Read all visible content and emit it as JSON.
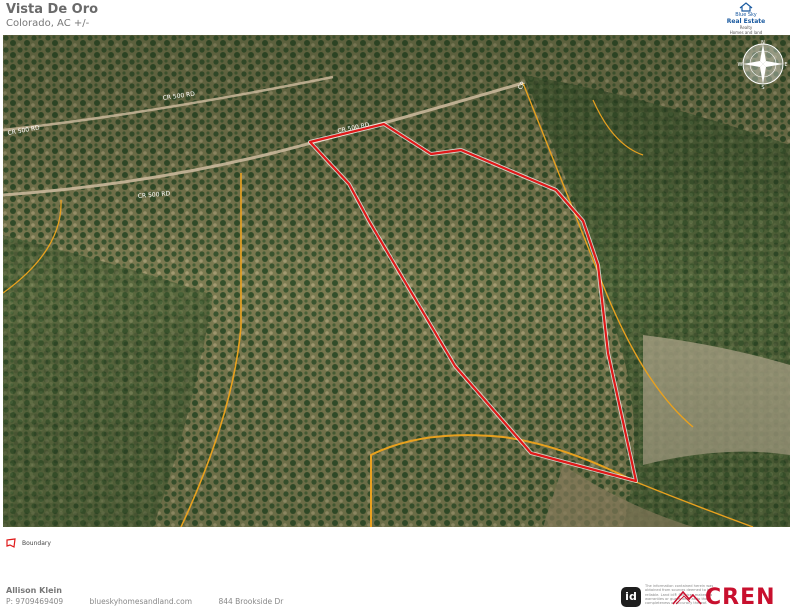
{
  "header": {
    "title": "Vista De Oro",
    "subtitle": "Colorado,  AC +/-"
  },
  "logo": {
    "line1": "Blue Sky",
    "line2": "Real Estate",
    "line3": "Realty",
    "line4": "Homes and land"
  },
  "compass": {
    "north": "N",
    "south": "S",
    "east": "E",
    "west": "W"
  },
  "map": {
    "road_labels": [
      "CR 500 RD",
      "CR 500 RD",
      "CR 500 RD",
      "CR 500 RD",
      "CR"
    ],
    "colors": {
      "boundary": "#e01919",
      "roads": "#e8a11f",
      "terrain": "#8b8a5a",
      "forest": "#3c5a2e"
    }
  },
  "legend": {
    "label": "Boundary",
    "icon": "boundary-polygon-icon"
  },
  "footer": {
    "agent_name": "Allison Klein",
    "phone": "P: 9709469409",
    "website": "blueskyhomesandland.com",
    "address": "844 Brookside Dr"
  },
  "disclaimer": "The information contained herein was obtained from sources deemed to be reliable. Land id® Services makes no warranties or guarantees as to the completeness or accuracy thereof.",
  "brand": {
    "id_badge": "id",
    "cren": "CREN"
  }
}
